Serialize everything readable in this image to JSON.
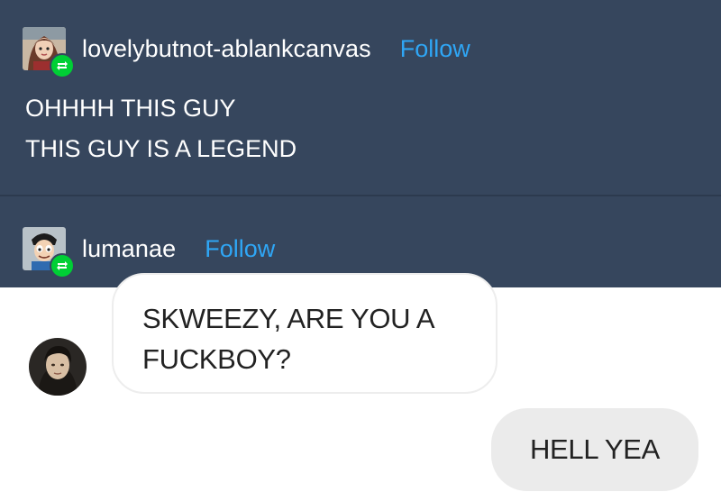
{
  "posts": [
    {
      "username": "lovelybutnot-ablankcanvas",
      "follow_label": "Follow",
      "avatar_icon": "illustrated-girl-avatar-icon",
      "badge_icon": "reblog-icon",
      "lines": [
        "OHHHH THIS GUY",
        "THIS GUY IS A LEGEND"
      ]
    },
    {
      "username": "lumanae",
      "follow_label": "Follow",
      "avatar_icon": "cartoon-character-avatar-icon",
      "badge_icon": "reblog-icon"
    }
  ],
  "chat": {
    "incoming": {
      "avatar_icon": "contact-photo-avatar",
      "lines": [
        "SKWEEZY, ARE YOU A",
        "FUCKBOY?"
      ]
    },
    "outgoing": {
      "text": "HELL YEA"
    }
  },
  "colors": {
    "panel": "#36465d",
    "follow": "#2fa6f5",
    "reblog": "#00cf35",
    "incoming_bubble_border": "#ededed",
    "outgoing_bubble": "#ebebeb"
  }
}
